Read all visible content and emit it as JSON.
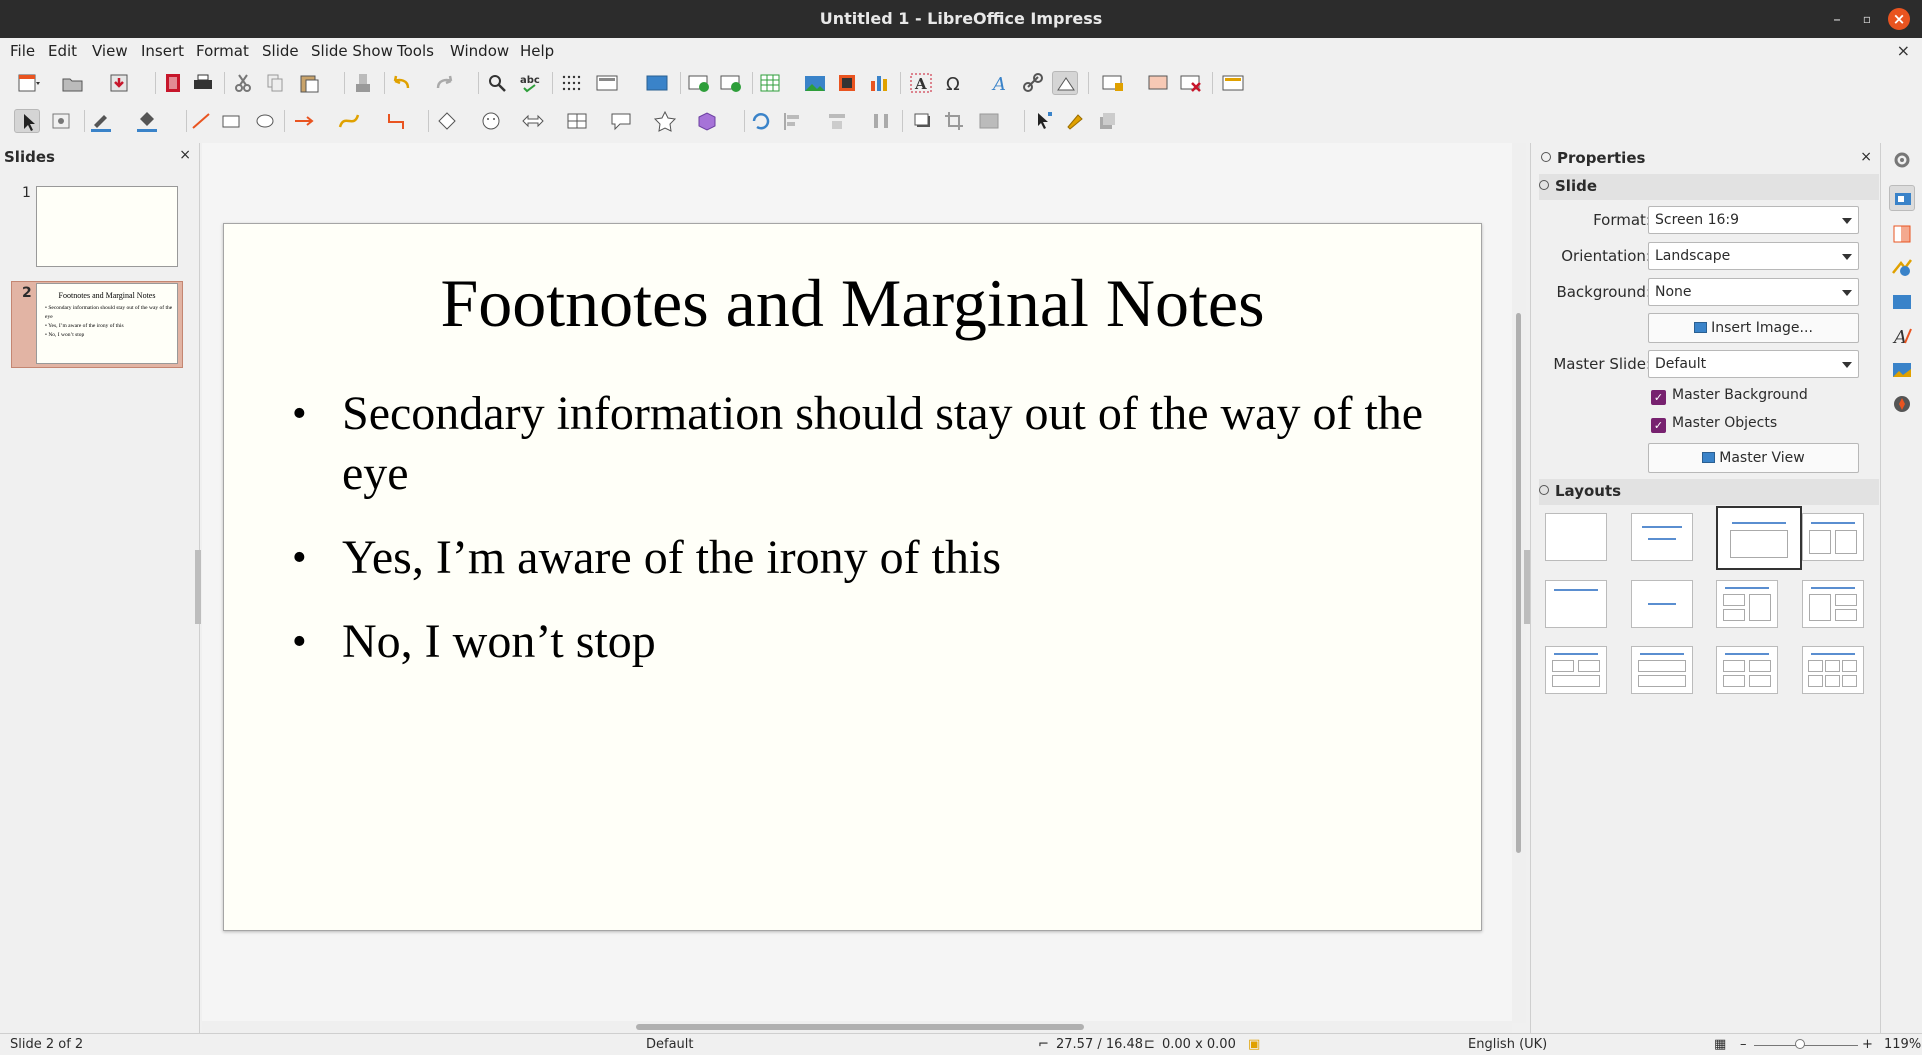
{
  "window": {
    "title": "Untitled 1 - LibreOffice Impress"
  },
  "menu": [
    "File",
    "Edit",
    "View",
    "Insert",
    "Format",
    "Slide",
    "Slide Show",
    "Tools",
    "Window",
    "Help"
  ],
  "slides_pane": {
    "title": "Slides",
    "slides": [
      {
        "number": "1",
        "title": "",
        "bullets": []
      },
      {
        "number": "2",
        "title": "Footnotes and Marginal Notes",
        "bullets": [
          "Secondary information should stay out of the way of the eye",
          "Yes, I’m aware of the irony of this",
          "No, I won’t stop"
        ]
      }
    ],
    "selected_slide": 2
  },
  "slide": {
    "title": "Footnotes and Marginal Notes",
    "bullets": [
      "Secondary information should stay out of the way of the eye",
      "Yes, I’m aware of the irony of this",
      "No, I won’t stop"
    ]
  },
  "properties": {
    "title": "Properties",
    "slide_section": {
      "heading": "Slide",
      "format": {
        "label": "Format:",
        "value": "Screen 16:9"
      },
      "orientation": {
        "label": "Orientation:",
        "value": "Landscape"
      },
      "background": {
        "label": "Background:",
        "value": "None"
      },
      "insert_image_label": "Insert Image...",
      "master_slide": {
        "label": "Master Slide:",
        "value": "Default"
      },
      "master_background": {
        "label": "Master Background",
        "checked": true
      },
      "master_objects": {
        "label": "Master Objects",
        "checked": true
      },
      "master_view_label": "Master View"
    },
    "layouts_section": {
      "heading": "Layouts",
      "selected_index": 2
    }
  },
  "statusbar": {
    "slide_info": "Slide 2 of 2",
    "master": "Default",
    "position": "27.57 / 16.48",
    "size": "0.00 x 0.00",
    "language": "English (UK)",
    "zoom": "119%"
  },
  "colors": {
    "titlebar": "#2c2c2c",
    "close_button": "#e95420",
    "checkbox": "#77216f",
    "slide_bg": "#fffff8",
    "selection": "#e2b4a4"
  }
}
